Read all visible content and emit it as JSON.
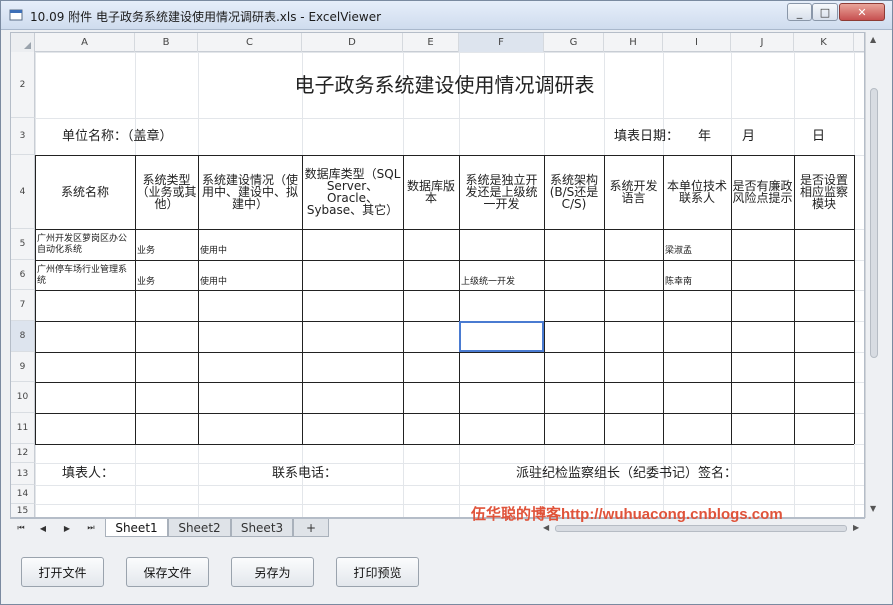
{
  "window": {
    "title": "10.09 附件 电子政务系统建设使用情况调研表.xls - ExcelViewer",
    "min_icon": "minimize-icon",
    "max_icon": "maximize-icon",
    "close_icon": "close-icon"
  },
  "columns": [
    "A",
    "B",
    "C",
    "D",
    "E",
    "F",
    "G",
    "H",
    "I",
    "J",
    "K"
  ],
  "rows": [
    "2",
    "3",
    "4",
    "5",
    "6",
    "7",
    "8",
    "9",
    "10",
    "11",
    "12",
    "13",
    "14",
    "15"
  ],
  "sheet": {
    "title": "电子政务系统建设使用情况调研表",
    "unit_label": "单位名称：（盖章）",
    "date_label": "填表日期：",
    "date_year": "年",
    "date_month": "月",
    "date_day": "日",
    "headers": [
      "系统名称",
      "系统类型（业务或其他）",
      "系统建设情况（使用中、建设中、拟建中）",
      "数据库类型（SQL Server、Oracle、Sybase、其它）",
      "数据库版本",
      "系统是独立开发还是上级统一开发",
      "系统架构(B/S还是C/S)",
      "系统开发语言",
      "本单位技术联系人",
      "是否有廉政风险点提示",
      "是否设置相应监察模块"
    ],
    "rows": [
      {
        "name": "广州开发区萝岗区办公自动化系统",
        "type": "业务",
        "status": "使用中",
        "dev": "",
        "contact": "梁淑孟"
      },
      {
        "name": "广州停车场行业管理系统",
        "type": "业务",
        "status": "使用中",
        "dev": "上级统一开发",
        "contact": "陈幸南"
      }
    ],
    "footer_filler": "填表人：",
    "footer_phone": "联系电话：",
    "footer_sign": "派驻纪检监察组长（纪委书记）签名："
  },
  "tabs": [
    "Sheet1",
    "Sheet2",
    "Sheet3"
  ],
  "add_tab": "+",
  "watermark": "伍华聪的博客http://wuhuacong.cnblogs.com",
  "buttons": {
    "open": "打开文件",
    "save": "保存文件",
    "save_as": "另存为",
    "preview": "打印预览"
  },
  "colors": {
    "title_bg": "#cfdcee",
    "watermark": "#e0533a",
    "selection": "#4a7bd1"
  }
}
